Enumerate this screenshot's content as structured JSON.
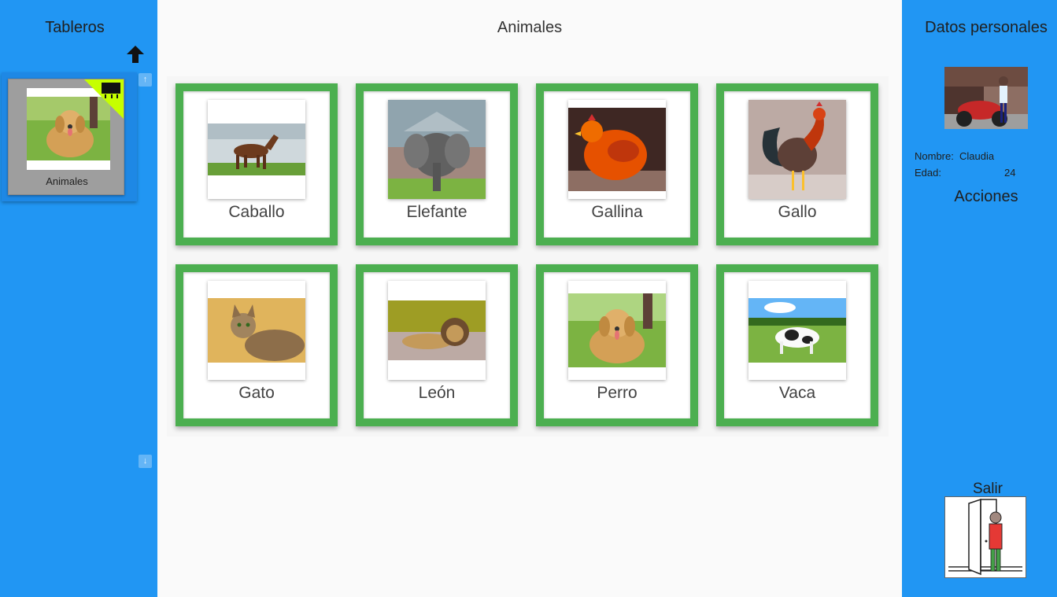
{
  "left_sidebar": {
    "title": "Tableros",
    "boards": [
      {
        "label": "Animales"
      }
    ]
  },
  "main": {
    "title": "Animales",
    "cells": [
      {
        "label": "Caballo",
        "icon": "horse-picture"
      },
      {
        "label": "Elefante",
        "icon": "elephant-picture"
      },
      {
        "label": "Gallina",
        "icon": "hen-picture"
      },
      {
        "label": "Gallo",
        "icon": "rooster-picture"
      },
      {
        "label": "Gato",
        "icon": "cat-picture"
      },
      {
        "label": "León",
        "icon": "lion-picture"
      },
      {
        "label": "Perro",
        "icon": "dog-picture"
      },
      {
        "label": "Vaca",
        "icon": "cow-picture"
      }
    ]
  },
  "right_sidebar": {
    "title": "Datos personales",
    "name_label": "Nombre:",
    "name_value": "Claudia",
    "age_label": "Edad:",
    "age_value": "24",
    "actions_title": "Acciones",
    "exit_label": "Salir"
  },
  "colors": {
    "sidebar": "#2196f3",
    "cell_border": "#4caf50",
    "background": "#fafafa"
  }
}
